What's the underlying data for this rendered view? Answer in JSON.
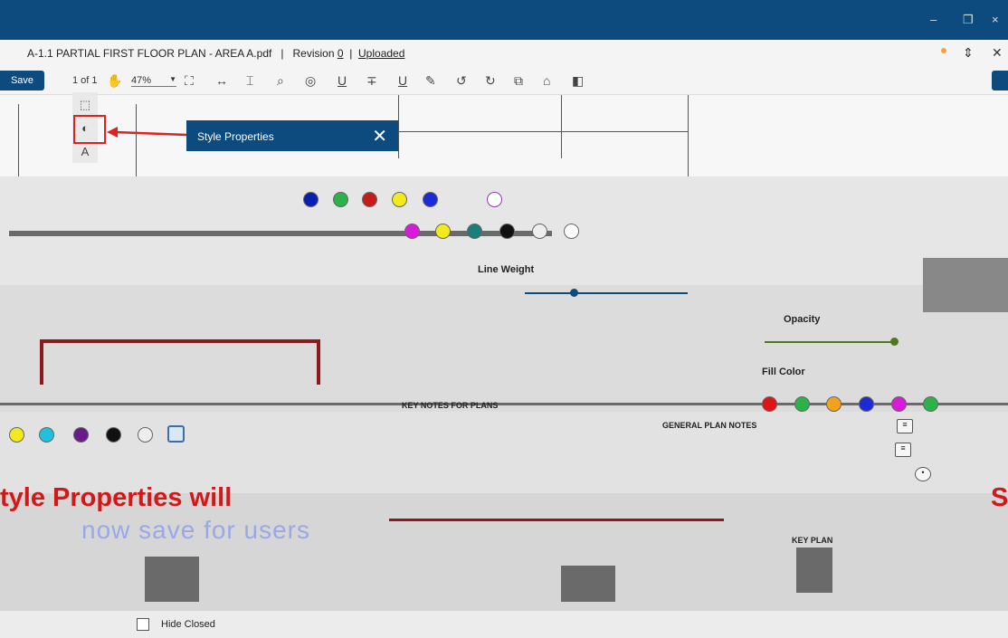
{
  "window": {
    "minimize": "–",
    "restore": "❐",
    "close": "×"
  },
  "document": {
    "title": "A-1.1 PARTIAL FIRST FLOOR PLAN - AREA A.pdf",
    "sep1": "|",
    "revision_label": "Revision",
    "revision_value": "0",
    "sep2": "|",
    "status": "Uploaded"
  },
  "toolbar": {
    "save_label": "Save",
    "page_count": "1 of 1",
    "zoom_value": "47%"
  },
  "style_panel": {
    "title": "Style Properties",
    "line_weight_label": "Line Weight",
    "opacity_label": "Opacity",
    "fill_color_label": "Fill Color"
  },
  "blueprint": {
    "key_notes": "KEY NOTES FOR PLANS",
    "general_notes": "GENERAL PLAN NOTES",
    "key_plan": "KEY PLAN"
  },
  "overlay": {
    "red_text_left": "tyle Properties will",
    "blue_text": "now save for users",
    "red_text_right": "S"
  },
  "footer": {
    "hide_closed_label": "Hide Closed"
  },
  "colors": {
    "brand": "#0d4a7d",
    "highlight": "#d22222"
  }
}
